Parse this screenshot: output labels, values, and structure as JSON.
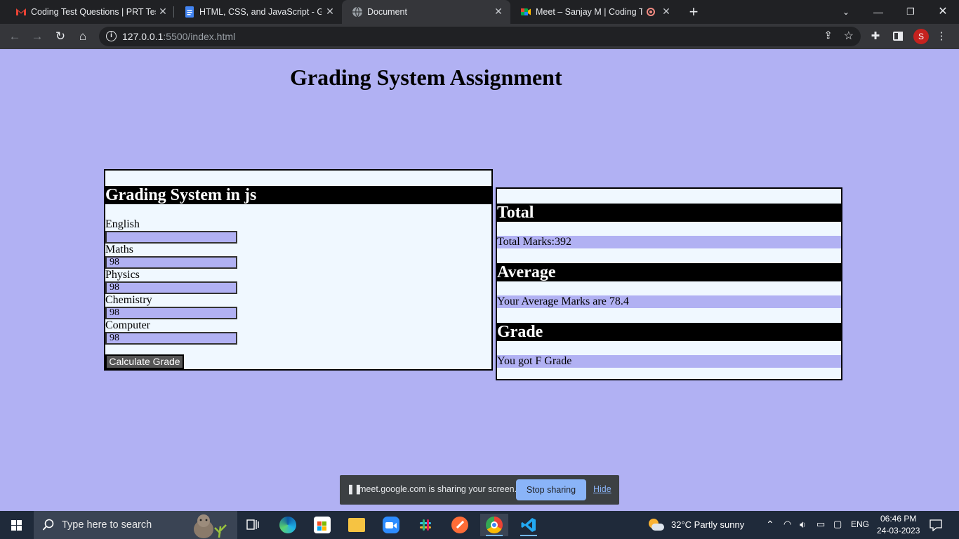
{
  "browser": {
    "tabs": [
      {
        "title": "Coding Test Questions | PRT Test",
        "favicon": "gmail-icon",
        "active": false
      },
      {
        "title": "HTML, CSS, and JavaScript - GRA",
        "favicon": "docs-icon",
        "active": false
      },
      {
        "title": "Document",
        "favicon": "globe-icon",
        "active": true
      },
      {
        "title": "Meet – Sanjay M | Coding Te",
        "favicon": "meet-icon",
        "active": false
      }
    ],
    "url_host": "127.0.0.1",
    "url_path": ":5500/index.html",
    "profile_initial": "S"
  },
  "page": {
    "heading": "Grading System Assignment",
    "form": {
      "title": "Grading System in js",
      "fields": [
        {
          "label": "English",
          "value": ""
        },
        {
          "label": "Maths",
          "value": "98"
        },
        {
          "label": "Physics",
          "value": "98"
        },
        {
          "label": "Chemistry",
          "value": "98"
        },
        {
          "label": "Computer",
          "value": "98"
        }
      ],
      "button_label": "Calculate Grade"
    },
    "results": {
      "total_heading": "Total",
      "total_text": "Total Marks:392",
      "average_heading": "Average",
      "average_text": "Your Average Marks are 78.4",
      "grade_heading": "Grade",
      "grade_text": "You got F Grade"
    }
  },
  "share_bar": {
    "text": "meet.google.com is sharing your screen.",
    "stop_label": "Stop sharing",
    "hide_label": "Hide"
  },
  "taskbar": {
    "search_placeholder": "Type here to search",
    "weather": "32°C  Partly sunny",
    "language": "ENG",
    "time": "06:46 PM",
    "date": "24-03-2023"
  },
  "colors": {
    "page_bg": "#b1b1f3",
    "panel_bg": "#f0f8ff",
    "band_bg": "#000000",
    "accent": "#8ab4f8"
  }
}
